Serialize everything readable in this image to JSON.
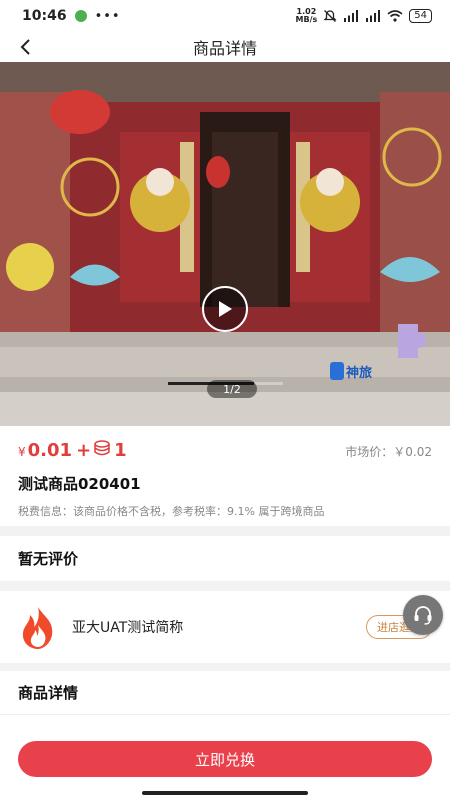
{
  "status_bar": {
    "time": "10:46",
    "dots": "•••",
    "net_speed_value": "1.02",
    "net_speed_unit": "MB/s",
    "battery": "54"
  },
  "nav": {
    "title": "商品详情",
    "back_icon": "chevron-left-icon"
  },
  "media": {
    "page_indicator": "1/2",
    "video_progress": 0.75,
    "play_icon": "play-icon",
    "watermark_logo_text": "神旅"
  },
  "product": {
    "price_currency": "¥",
    "price": "0.01",
    "plus": "+",
    "points": "1",
    "coin_icon": "coins-icon",
    "market_price": "市场价：￥0.02",
    "name": "测试商品020401",
    "tax_info": "税费信息：该商品价格不含税，参考税率：9.1% 属于跨境商品"
  },
  "reviews": {
    "title": "暂无评价"
  },
  "store": {
    "logo_icon": "flame-icon",
    "name": "亚大UAT测试简称",
    "visit_label": "进店逛逛",
    "service_icon": "headset-icon"
  },
  "details": {
    "title": "商品详情"
  },
  "actions": {
    "redeem_label": "立即兑换"
  },
  "colors": {
    "accent_red": "#e8414b",
    "price_red": "#e23d3d",
    "visit_orange": "#d79a5b"
  }
}
